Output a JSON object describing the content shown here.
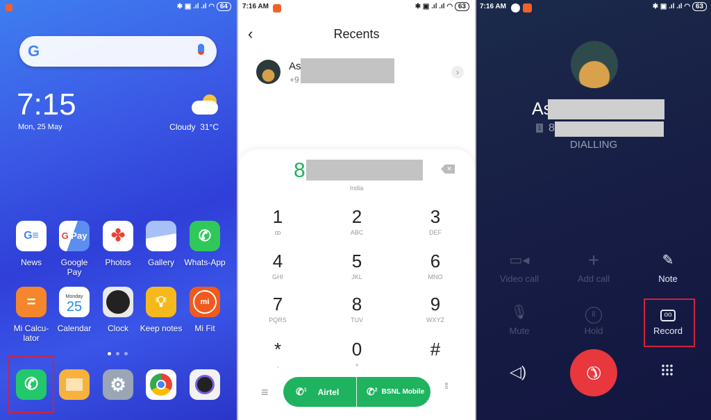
{
  "home": {
    "battery": "64",
    "time": "7:15",
    "date": "Mon, 25 May",
    "weather": {
      "condition": "Cloudy",
      "temp": "31°C"
    },
    "apps_row1": [
      {
        "label": "News",
        "icon": "google-news-icon",
        "color": "#ffffff"
      },
      {
        "label": "Google Pay",
        "icon": "google-pay-icon",
        "color": "#ffffff"
      },
      {
        "label": "Photos",
        "icon": "google-photos-icon",
        "color": "#ffffff"
      },
      {
        "label": "Gallery",
        "icon": "gallery-icon",
        "color": "#8fb4f5"
      },
      {
        "label": "Whats-App",
        "icon": "whatsapp-icon",
        "color": "#2fc85a"
      }
    ],
    "apps_row2": [
      {
        "label": "Mi Calcu-lator",
        "icon": "calculator-icon",
        "color": "#f5862c"
      },
      {
        "label": "Calendar",
        "icon": "calendar-icon",
        "color": "#ffffff",
        "day": "Monday",
        "date": "25"
      },
      {
        "label": "Clock",
        "icon": "clock-icon",
        "color": "#e9e9e9"
      },
      {
        "label": "Keep notes",
        "icon": "lightbulb-icon",
        "color": "#f6b91c"
      },
      {
        "label": "Mi Fit",
        "icon": "mi-fit-icon",
        "color": "#f05a1e",
        "text": "mi"
      }
    ],
    "dock": [
      {
        "icon": "phone-icon",
        "color": "#22c86a"
      },
      {
        "icon": "messages-icon",
        "color": "#f7b13c"
      },
      {
        "icon": "settings-icon",
        "color": "#9aa5b5"
      },
      {
        "icon": "chrome-icon",
        "color": "#ffffff"
      },
      {
        "icon": "camera-icon",
        "color": "#f2f2f2"
      }
    ]
  },
  "dialer": {
    "status_time": "7:16 AM",
    "battery": "63",
    "title": "Recents",
    "recent": {
      "name_prefix": "As",
      "number_prefix": "+9"
    },
    "typed_prefix": "8",
    "country": "India",
    "keys": [
      {
        "digit": "1",
        "letters": "ꝏ"
      },
      {
        "digit": "2",
        "letters": "ABC"
      },
      {
        "digit": "3",
        "letters": "DEF"
      },
      {
        "digit": "4",
        "letters": "GHI"
      },
      {
        "digit": "5",
        "letters": "JKL"
      },
      {
        "digit": "6",
        "letters": "MNO"
      },
      {
        "digit": "7",
        "letters": "PQRS"
      },
      {
        "digit": "8",
        "letters": "TUV"
      },
      {
        "digit": "9",
        "letters": "WXYZ"
      },
      {
        "digit": "*",
        "letters": ","
      },
      {
        "digit": "0",
        "letters": "+"
      },
      {
        "digit": "#",
        "letters": ""
      }
    ],
    "sim1": {
      "label": "Airtel",
      "slot": "1"
    },
    "sim2": {
      "label": "BSNL Mobile",
      "slot": "2"
    },
    "accent": "#1fb25f"
  },
  "call": {
    "status_time": "7:16 AM",
    "battery": "63",
    "name_prefix": "As",
    "sim_slot": "1",
    "number_prefix": "8",
    "state": "DIALLING",
    "actions": [
      {
        "label": "Video call",
        "icon": "video-call-icon",
        "enabled": false
      },
      {
        "label": "Add call",
        "icon": "add-call-icon",
        "enabled": false
      },
      {
        "label": "Note",
        "icon": "note-icon",
        "enabled": true
      },
      {
        "label": "Mute",
        "icon": "mute-icon",
        "enabled": false
      },
      {
        "label": "Hold",
        "icon": "hold-icon",
        "enabled": false
      },
      {
        "label": "Record",
        "icon": "record-icon",
        "enabled": true
      }
    ],
    "end_call_color": "#e8373d",
    "highlight_color": "#d6203a"
  }
}
